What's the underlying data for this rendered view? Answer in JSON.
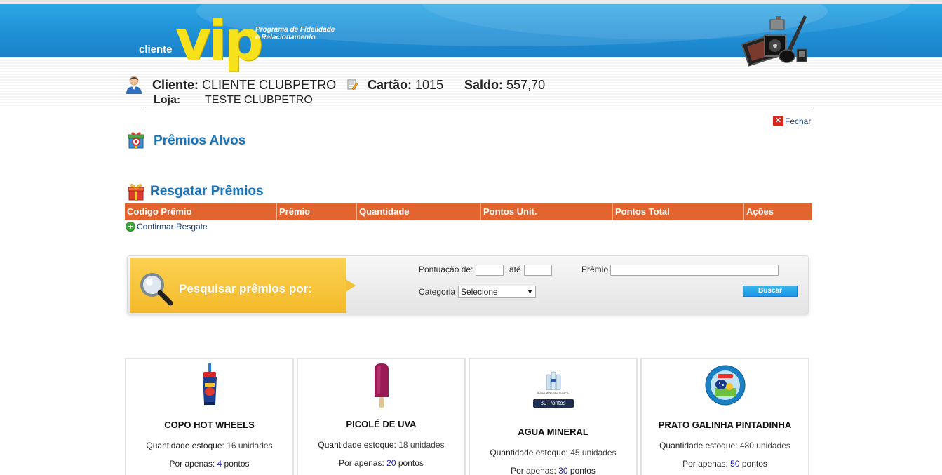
{
  "header": {
    "logo_cliente": "cliente",
    "logo_vip": "vip",
    "tagline_1": "Programa de Fidelidade",
    "tagline_2": "e Relacionamento"
  },
  "client": {
    "cliente_label": "Cliente:",
    "cliente_name": "CLIENTE CLUBPETRO",
    "cartao_label": "Cartão:",
    "cartao_value": "1015",
    "saldo_label": "Saldo:",
    "saldo_value": "557,70",
    "loja_label": "Loja:",
    "loja_value": "TESTE CLUBPETRO"
  },
  "actions": {
    "fechar": "Fechar",
    "confirmar": "Confirmar Resgate"
  },
  "sections": {
    "premios_alvos": "Prêmios Alvos",
    "resgatar": "Resgatar Prêmios"
  },
  "table": {
    "columns": [
      "Codigo Prêmio",
      "Prêmio",
      "Quantidade",
      "Pontos Unit.",
      "Pontos Total",
      "Ações"
    ]
  },
  "search": {
    "title": "Pesquisar prêmios por:",
    "pontuacao_label": "Pontuação de:",
    "ate_label": "até",
    "premio_label": "Prêmio",
    "categoria_label": "Categoria",
    "categoria_selected": "Selecione",
    "pontuacao_de_value": "",
    "pontuacao_ate_value": "",
    "premio_value": "",
    "buscar": "Buscar"
  },
  "products": [
    {
      "name": "COPO HOT WHEELS",
      "stock_label": "Quantidade estoque:",
      "stock": "16 unidades",
      "price_prefix": "Por apenas:",
      "points": "4",
      "points_suffix": "pontos"
    },
    {
      "name": "PICOLÉ DE UVA",
      "stock_label": "Quantidade estoque:",
      "stock": "18 unidades",
      "price_prefix": "Por apenas:",
      "points": "20",
      "points_suffix": "pontos"
    },
    {
      "name": "AGUA MINERAL",
      "stock_label": "Quantidade estoque:",
      "stock": "45 unidades",
      "price_prefix": "Por apenas:",
      "points": "30",
      "points_suffix": "pontos",
      "badge": "30 Pontos",
      "image_caption": "ÁGUA MINERAL SOUPIL"
    },
    {
      "name": "PRATO GALINHA PINTADINHA",
      "stock_label": "Quantidade estoque:",
      "stock": "480 unidades",
      "price_prefix": "Por apenas:",
      "points": "50",
      "points_suffix": "pontos"
    }
  ]
}
